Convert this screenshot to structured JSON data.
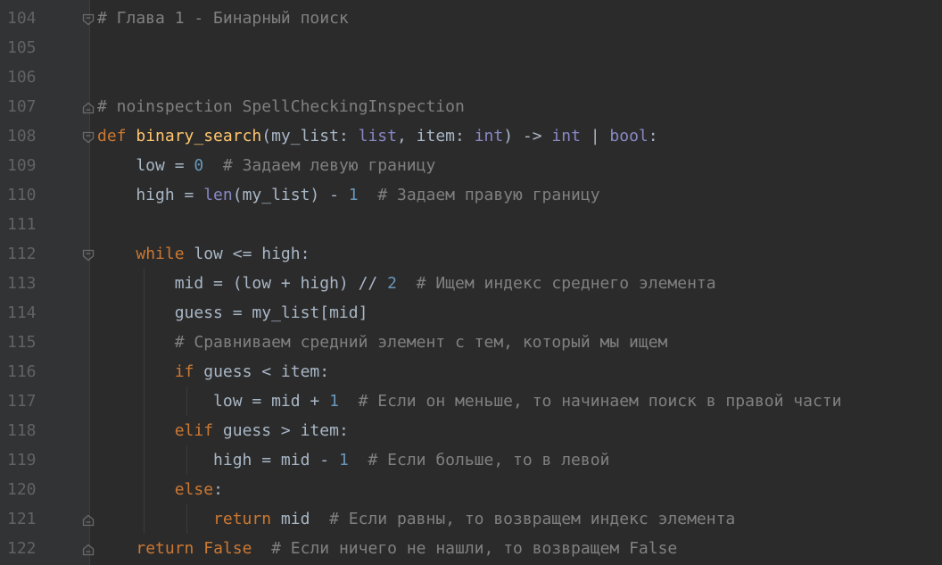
{
  "lines": [
    {
      "n": "104",
      "tokens": [
        [
          "cm",
          "# Глава 1 - Бинарный поиск"
        ]
      ]
    },
    {
      "n": "105",
      "tokens": []
    },
    {
      "n": "106",
      "tokens": []
    },
    {
      "n": "107",
      "tokens": [
        [
          "cm",
          "# noinspection SpellCheckingInspection"
        ]
      ]
    },
    {
      "n": "108",
      "tokens": [
        [
          "kw",
          "def "
        ],
        [
          "fn",
          "binary_search"
        ],
        [
          "tx",
          "(my_list: "
        ],
        [
          "bi",
          "list"
        ],
        [
          "tx",
          ", item: "
        ],
        [
          "bi",
          "int"
        ],
        [
          "tx",
          ") -> "
        ],
        [
          "bi",
          "int"
        ],
        [
          "tx",
          " | "
        ],
        [
          "bi",
          "bool"
        ],
        [
          "tx",
          ":"
        ]
      ]
    },
    {
      "n": "109",
      "tokens": [
        [
          "tx",
          "    low = "
        ],
        [
          "num",
          "0"
        ],
        [
          "tx",
          "  "
        ],
        [
          "cm",
          "# Задаем левую границу"
        ]
      ]
    },
    {
      "n": "110",
      "tokens": [
        [
          "tx",
          "    high = "
        ],
        [
          "bi",
          "len"
        ],
        [
          "tx",
          "(my_list) - "
        ],
        [
          "num",
          "1"
        ],
        [
          "tx",
          "  "
        ],
        [
          "cm",
          "# Задаем правую границу"
        ]
      ]
    },
    {
      "n": "111",
      "tokens": []
    },
    {
      "n": "112",
      "tokens": [
        [
          "tx",
          "    "
        ],
        [
          "kw",
          "while"
        ],
        [
          "tx",
          " low <= high:"
        ]
      ]
    },
    {
      "n": "113",
      "tokens": [
        [
          "tx",
          "        mid = (low + high) // "
        ],
        [
          "num",
          "2"
        ],
        [
          "tx",
          "  "
        ],
        [
          "cm",
          "# Ищем индекс среднего элемента"
        ]
      ]
    },
    {
      "n": "114",
      "tokens": [
        [
          "tx",
          "        guess = my_list[mid]"
        ]
      ]
    },
    {
      "n": "115",
      "tokens": [
        [
          "tx",
          "        "
        ],
        [
          "cm",
          "# Сравниваем средний элемент с тем, который мы ищем"
        ]
      ]
    },
    {
      "n": "116",
      "tokens": [
        [
          "tx",
          "        "
        ],
        [
          "kw",
          "if"
        ],
        [
          "tx",
          " guess < item:"
        ]
      ]
    },
    {
      "n": "117",
      "tokens": [
        [
          "tx",
          "            low = mid + "
        ],
        [
          "num",
          "1"
        ],
        [
          "tx",
          "  "
        ],
        [
          "cm",
          "# Если он меньше, то начинаем поиск в правой части"
        ]
      ]
    },
    {
      "n": "118",
      "tokens": [
        [
          "tx",
          "        "
        ],
        [
          "kw",
          "elif"
        ],
        [
          "tx",
          " guess > item:"
        ]
      ]
    },
    {
      "n": "119",
      "tokens": [
        [
          "tx",
          "            high = mid - "
        ],
        [
          "num",
          "1"
        ],
        [
          "tx",
          "  "
        ],
        [
          "cm",
          "# Если больше, то в левой"
        ]
      ]
    },
    {
      "n": "120",
      "tokens": [
        [
          "tx",
          "        "
        ],
        [
          "kw",
          "else"
        ],
        [
          "tx",
          ":"
        ]
      ]
    },
    {
      "n": "121",
      "tokens": [
        [
          "tx",
          "            "
        ],
        [
          "kw",
          "return"
        ],
        [
          "tx",
          " mid  "
        ],
        [
          "cm",
          "# Если равны, то возвращем индекс элемента"
        ]
      ]
    },
    {
      "n": "122",
      "tokens": [
        [
          "tx",
          "    "
        ],
        [
          "kw",
          "return"
        ],
        [
          "tx",
          " "
        ],
        [
          "kw",
          "False"
        ],
        [
          "tx",
          "  "
        ],
        [
          "cm",
          "# Если ничего не нашли, то возвращем False"
        ]
      ]
    }
  ],
  "folds": {
    "104": "fold-open",
    "107": "fold-end",
    "108": "fold-open",
    "112": "fold-open",
    "121": "fold-end",
    "122": "fold-end"
  },
  "colors": {
    "background": "#2b2b2b",
    "gutter": "#313335",
    "line_number": "#606366",
    "text": "#a9b7c6",
    "keyword": "#cc7832",
    "function": "#ffc66d",
    "number": "#6897bb",
    "comment": "#808080",
    "builtin": "#8888c6"
  }
}
